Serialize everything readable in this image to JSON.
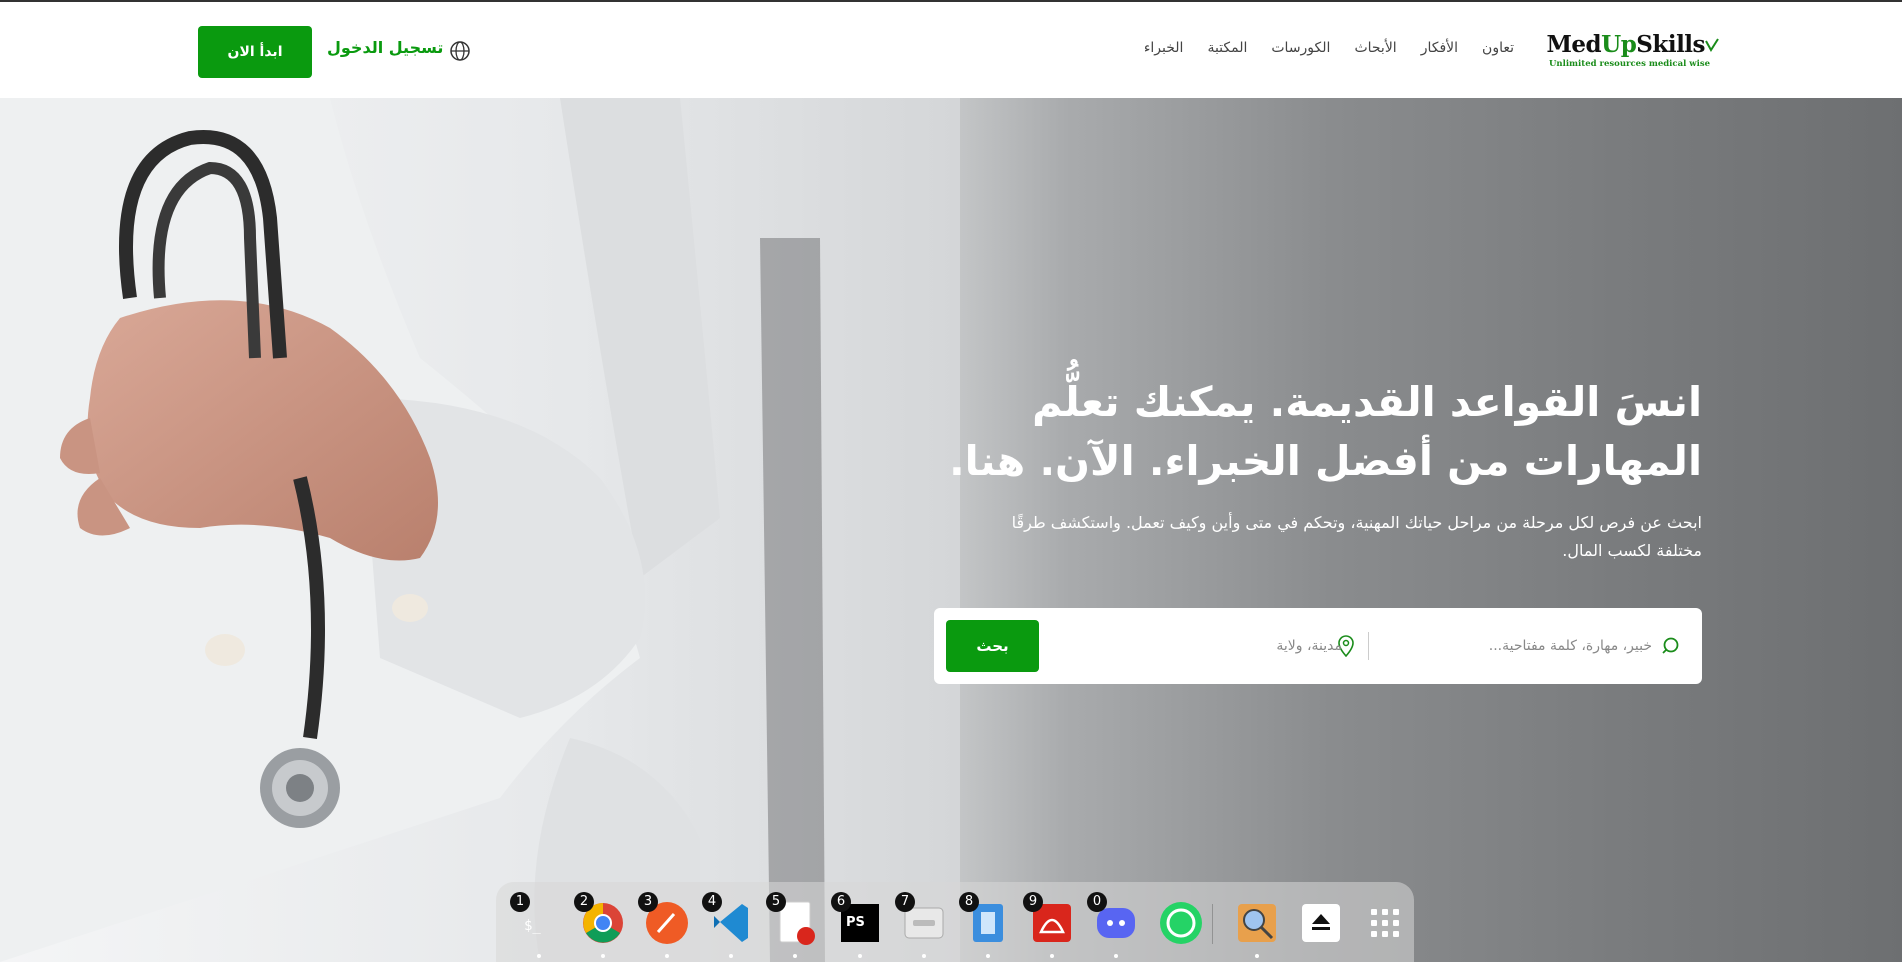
{
  "header": {
    "logo": {
      "text_med": "Med",
      "text_up": "Up",
      "text_skills": "Skills",
      "tagline": "Unlimited resources medical wise"
    },
    "nav": [
      "الخبراء",
      "المكتبة",
      "الكورسات",
      "الأبحاث",
      "الأفكار",
      "تعاون"
    ],
    "login_label": "تسجيل الدخول",
    "start_label": "ابدأ الان",
    "globe_icon": "globe-icon"
  },
  "hero": {
    "title_line1": "انسَ القواعد القديمة. يمكنك تعلُّم",
    "title_line2": "المهارات من أفضل الخبراء. الآن. هنا.",
    "subtitle": "ابحث عن فرص لكل مرحلة من مراحل حياتك المهنية، وتحكم في متى وأين وكيف تعمل. واستكشف طرقًا مختلفة لكسب المال.",
    "search": {
      "keyword_placeholder": "خبير، مهارة، كلمة مفتاحية...",
      "location_placeholder": "مدينة، ولاية",
      "button_label": "بحث"
    }
  },
  "dock": {
    "items": [
      {
        "num": "1",
        "name": "terminal-icon",
        "color": "#1e1e1e"
      },
      {
        "num": "2",
        "name": "chrome-icon",
        "color": "#4285f4"
      },
      {
        "num": "3",
        "name": "postman-icon",
        "color": "#ef5b25"
      },
      {
        "num": "4",
        "name": "vscode-icon",
        "color": "#1f8ad2"
      },
      {
        "num": "5",
        "name": "text-editor-icon",
        "color": "#f4f4f4"
      },
      {
        "num": "6",
        "name": "phpstorm-icon",
        "color": "#7b3ff2"
      },
      {
        "num": "7",
        "name": "files-icon",
        "color": "#5c8ed6"
      },
      {
        "num": "8",
        "name": "reader-icon",
        "color": "#3b8ede"
      },
      {
        "num": "9",
        "name": "pdf-icon",
        "color": "#d9261c"
      },
      {
        "num": "0",
        "name": "discord-icon",
        "color": "#5865f2"
      },
      {
        "num": "",
        "name": "whatsapp-icon",
        "color": "#25d366"
      },
      {
        "num": "",
        "name": "image-viewer-icon",
        "color": "#e8a04c"
      },
      {
        "num": "",
        "name": "eject-icon",
        "color": "#ffffff"
      },
      {
        "num": "",
        "name": "app-grid-icon",
        "color": "#ffffff"
      }
    ]
  }
}
